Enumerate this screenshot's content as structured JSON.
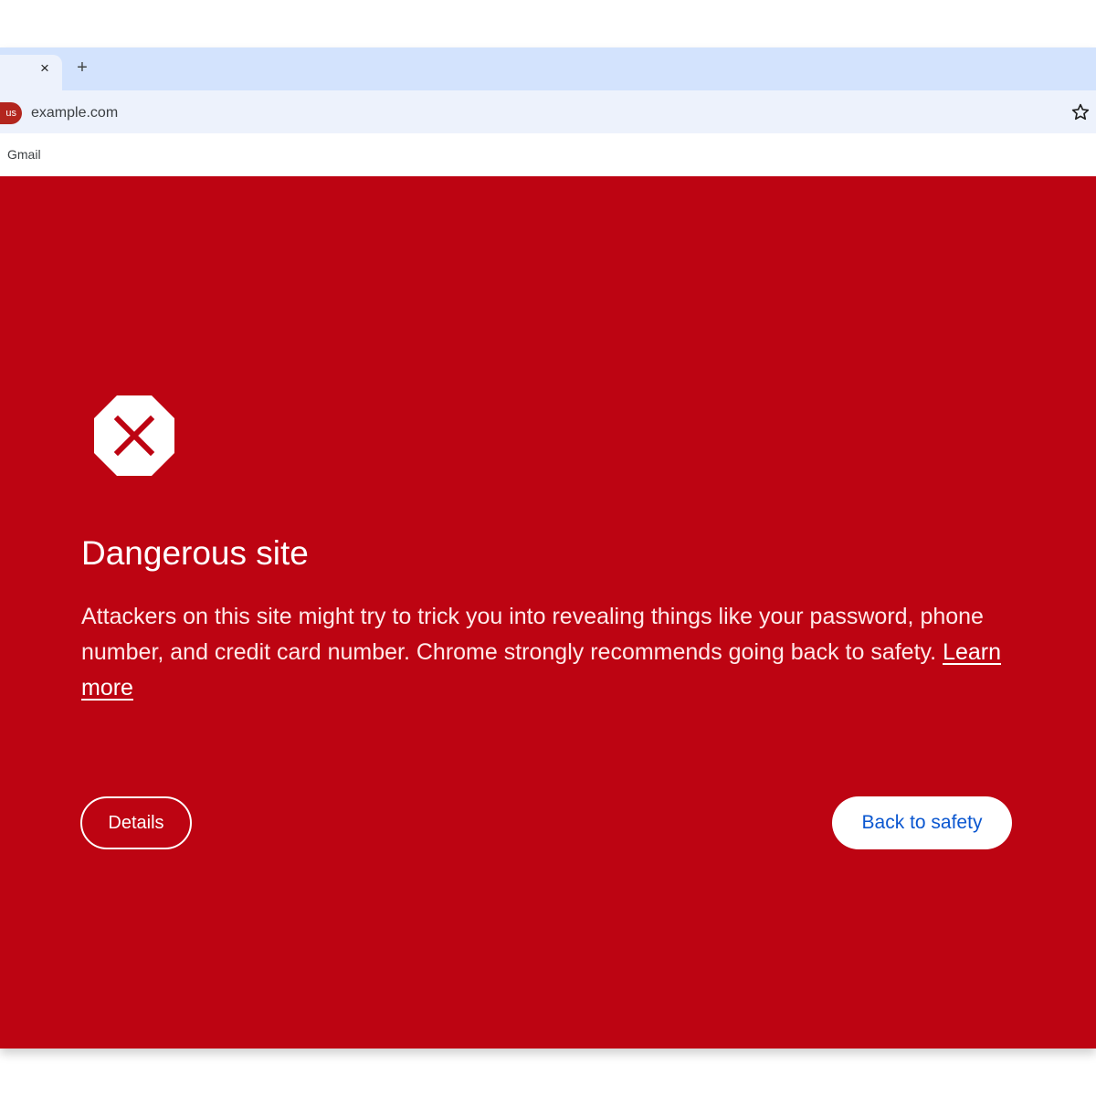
{
  "browser": {
    "tab": {
      "close_glyph": "×",
      "close_icon": "close-icon"
    },
    "new_tab_glyph": "+",
    "new_tab_icon": "plus-icon",
    "omnibox": {
      "security_chip": "us",
      "url": "example.com",
      "bookmark_star_icon": "star-outline-icon"
    },
    "bookmarks": [
      {
        "label": "Gmail"
      }
    ]
  },
  "interstitial": {
    "icon": "danger-octagon-x-icon",
    "title": "Dangerous site",
    "body": "Attackers on this site might try to trick you into revealing things like your password, phone number, and credit card number. Chrome strongly recommends going back to safety.",
    "learn_more": "Learn more",
    "details_button": "Details",
    "back_button": "Back to safety"
  },
  "colors": {
    "background_red": "#bd0412",
    "tab_strip": "#d3e3fd",
    "toolbar": "#edf2fc",
    "primary_blue": "#0b57d0",
    "chip_red": "#b3261e"
  }
}
